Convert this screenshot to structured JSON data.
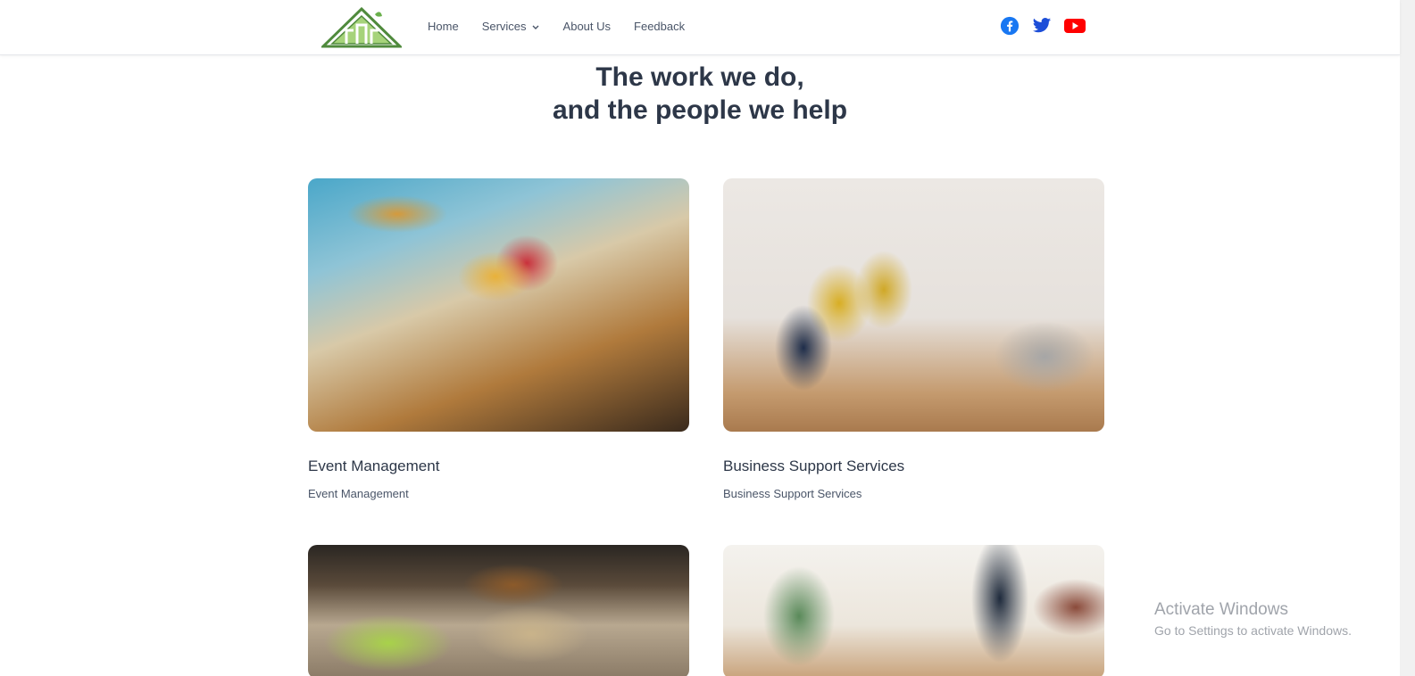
{
  "header": {
    "logo_icon": "pyramid-logo-icon",
    "nav": [
      {
        "label": "Home"
      },
      {
        "label": "Services",
        "has_dropdown": true
      },
      {
        "label": "About Us"
      },
      {
        "label": "Feedback"
      }
    ],
    "social": [
      {
        "icon": "facebook-icon",
        "color": "#1877f2"
      },
      {
        "icon": "twitter-icon",
        "color": "#1d4ed8"
      },
      {
        "icon": "youtube-icon",
        "color": "#ff0000"
      }
    ]
  },
  "hero": {
    "title_line1": "The work we do,",
    "title_line2": "and the people we help"
  },
  "cards": [
    {
      "title": "Event Management",
      "subtitle": "Event Management",
      "image": "banquet table with glasses and flowers"
    },
    {
      "title": "Business Support Services",
      "subtitle": "Business Support Services",
      "image": "people meeting in office lounge"
    },
    {
      "image": "catering food trays"
    },
    {
      "image": "person mopping floor"
    }
  ],
  "watermark": {
    "line1": "Activate Windows",
    "line2": "Go to Settings to activate Windows."
  },
  "colors": {
    "text": "#2d3748",
    "brand_green": "#6ab04c"
  }
}
